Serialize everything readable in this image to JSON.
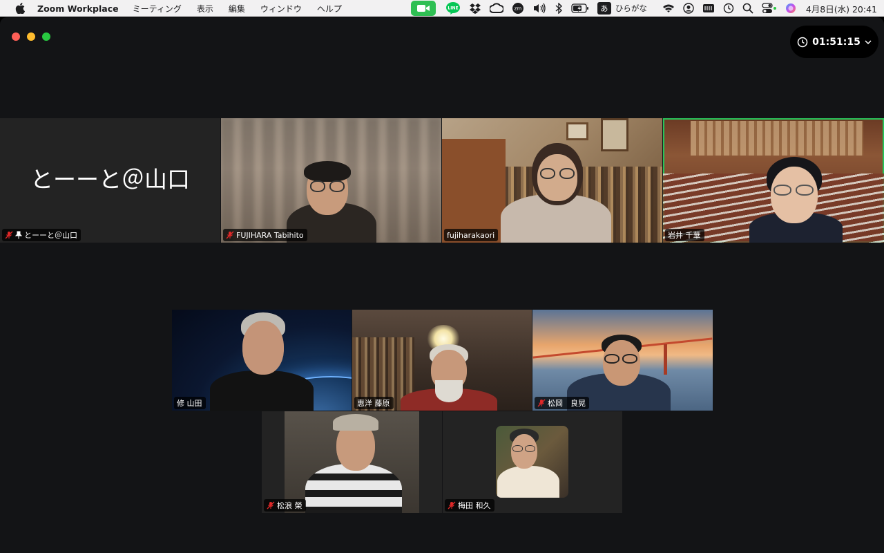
{
  "menubar": {
    "app_name": "Zoom Workplace",
    "menus": [
      "ミーティング",
      "表示",
      "編集",
      "ウィンドウ",
      "ヘルプ"
    ],
    "line_label": "LINE",
    "zm_label": "zm",
    "ime_char": "あ",
    "ime_label": "ひらがな",
    "datetime": "4月8日(水)  20:41"
  },
  "window": {
    "timer": "01:51:15"
  },
  "participants": [
    {
      "name": "とーーと＠山口",
      "display": "とーーと＠山口",
      "muted": true,
      "pinned": true,
      "video": false
    },
    {
      "name": "FUJIHARA Tabihito",
      "muted": true,
      "video": true
    },
    {
      "name": "fujiharakaori",
      "muted": false,
      "video": true
    },
    {
      "name": "岩井 千華",
      "muted": false,
      "video": true,
      "active_speaker": true
    },
    {
      "name": "修 山田",
      "muted": false,
      "video": true
    },
    {
      "name": "惠洋 藤原",
      "muted": false,
      "video": true
    },
    {
      "name": "松岡　良晃",
      "muted": true,
      "video": true
    },
    {
      "name": "松浪 榮",
      "muted": true,
      "video": true
    },
    {
      "name": "梅田 和久",
      "muted": true,
      "video": true
    }
  ],
  "colors": {
    "active_speaker_border": "#27c45a",
    "mute_icon": "#e02828",
    "zoom_tray": "#2fbf53"
  }
}
